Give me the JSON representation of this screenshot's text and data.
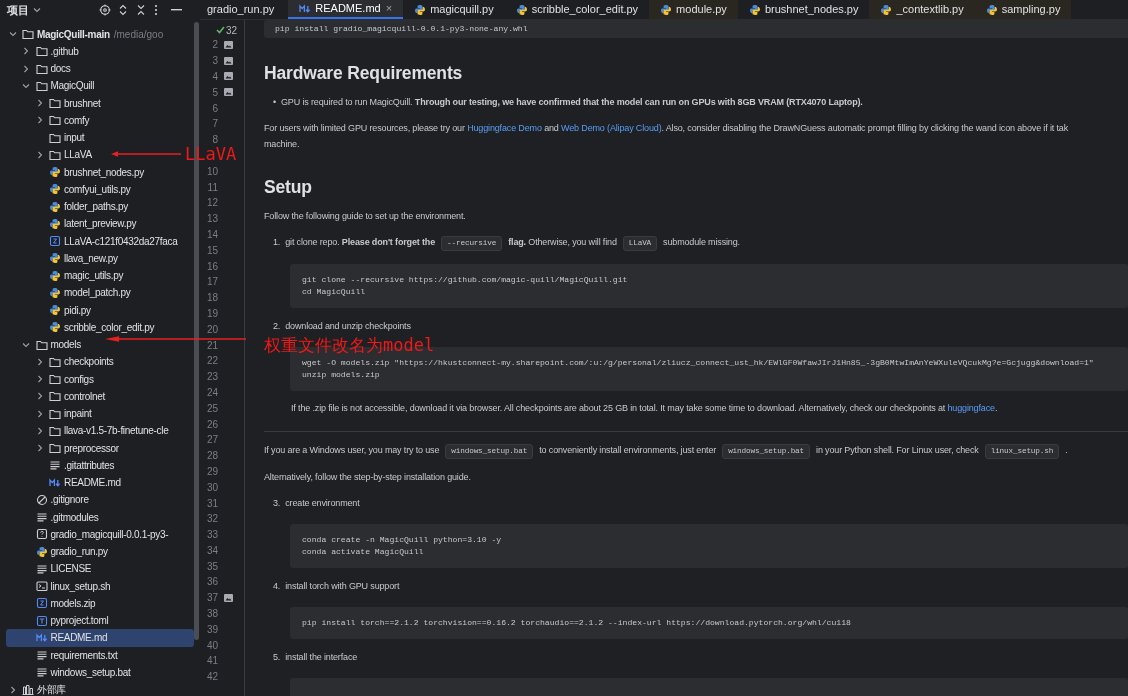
{
  "project_panel": {
    "title": "项目",
    "tree": [
      {
        "name": "MagicQuill-main",
        "kind": "folder",
        "expanded": true,
        "selected": false,
        "hint": "/media/goo",
        "children": [
          {
            "name": ".github",
            "kind": "folder",
            "expanded": false,
            "selected": false
          },
          {
            "name": "docs",
            "kind": "folder",
            "expanded": false,
            "selected": false
          },
          {
            "name": "MagicQuill",
            "kind": "folder",
            "expanded": true,
            "selected": false,
            "children": [
              {
                "name": "brushnet",
                "kind": "folder",
                "expanded": false,
                "selected": false
              },
              {
                "name": "comfy",
                "kind": "folder",
                "expanded": false,
                "selected": false
              },
              {
                "name": "input",
                "kind": "emptyfolder",
                "selected": false
              },
              {
                "name": "LLaVA",
                "kind": "folder",
                "expanded": false,
                "selected": false
              },
              {
                "name": "brushnet_nodes.py",
                "kind": "python",
                "selected": false
              },
              {
                "name": "comfyui_utils.py",
                "kind": "python",
                "selected": false
              },
              {
                "name": "folder_paths.py",
                "kind": "python",
                "selected": false
              },
              {
                "name": "latent_preview.py",
                "kind": "python",
                "selected": false
              },
              {
                "name": "LLaVA-c121f0432da27faca",
                "kind": "archive",
                "selected": false
              },
              {
                "name": "llava_new.py",
                "kind": "python",
                "selected": false
              },
              {
                "name": "magic_utils.py",
                "kind": "python",
                "selected": false
              },
              {
                "name": "model_patch.py",
                "kind": "python",
                "selected": false
              },
              {
                "name": "pidi.py",
                "kind": "python",
                "selected": false
              },
              {
                "name": "scribble_color_edit.py",
                "kind": "python",
                "selected": false
              }
            ]
          },
          {
            "name": "models",
            "kind": "folder",
            "expanded": true,
            "selected": false,
            "children": [
              {
                "name": "checkpoints",
                "kind": "folder",
                "expanded": false,
                "selected": false
              },
              {
                "name": "configs",
                "kind": "folder",
                "expanded": false,
                "selected": false
              },
              {
                "name": "controlnet",
                "kind": "folder",
                "expanded": false,
                "selected": false
              },
              {
                "name": "inpaint",
                "kind": "folder",
                "expanded": false,
                "selected": false
              },
              {
                "name": "llava-v1.5-7b-finetune-cle",
                "kind": "folder",
                "expanded": false,
                "selected": false
              },
              {
                "name": "preprocessor",
                "kind": "folder",
                "expanded": false,
                "selected": false
              },
              {
                "name": ".gitattributes",
                "kind": "lines",
                "selected": false
              },
              {
                "name": "README.md",
                "kind": "markdown",
                "selected": false
              }
            ]
          },
          {
            "name": ".gitignore",
            "kind": "ignore",
            "selected": false
          },
          {
            "name": ".gitmodules",
            "kind": "lines",
            "selected": false
          },
          {
            "name": "gradio_magicquill-0.0.1-py3-",
            "kind": "unknown",
            "selected": false
          },
          {
            "name": "gradio_run.py",
            "kind": "python",
            "selected": false
          },
          {
            "name": "LICENSE",
            "kind": "lines",
            "selected": false
          },
          {
            "name": "linux_setup.sh",
            "kind": "shell",
            "selected": false
          },
          {
            "name": "models.zip",
            "kind": "archive",
            "selected": false
          },
          {
            "name": "pyproject.toml",
            "kind": "toml",
            "selected": false
          },
          {
            "name": "README.md",
            "kind": "markdown",
            "selected": true
          },
          {
            "name": "requirements.txt",
            "kind": "lines",
            "selected": false
          },
          {
            "name": "windows_setup.bat",
            "kind": "lines",
            "selected": false
          }
        ]
      },
      {
        "name": "外部库",
        "kind": "library",
        "expanded": false,
        "selected": false
      }
    ]
  },
  "tabs": [
    {
      "label": "gradio_run.py",
      "kind": "plain",
      "selected": false,
      "external": false
    },
    {
      "label": "README.md",
      "kind": "markdown",
      "selected": true,
      "external": false,
      "close": "×"
    },
    {
      "label": "magicquill.py",
      "kind": "python",
      "selected": false,
      "external": false
    },
    {
      "label": "scribble_color_edit.py",
      "kind": "python",
      "selected": false,
      "external": false
    },
    {
      "label": "module.py",
      "kind": "python",
      "selected": false,
      "external": true
    },
    {
      "label": "brushnet_nodes.py",
      "kind": "python",
      "selected": false,
      "external": false
    },
    {
      "label": "_contextlib.py",
      "kind": "python",
      "selected": false,
      "external": true
    },
    {
      "label": "sampling.py",
      "kind": "python",
      "selected": false,
      "external": true
    }
  ],
  "gutter": {
    "inspection_count": "32",
    "lines": [
      {
        "n": "2",
        "image": true
      },
      {
        "n": "3",
        "image": true
      },
      {
        "n": "4",
        "image": true
      },
      {
        "n": "5",
        "image": true
      },
      {
        "n": "6",
        "image": false
      },
      {
        "n": "7",
        "image": false
      },
      {
        "n": "8",
        "image": false
      },
      {
        "n": "10",
        "image": false
      },
      {
        "n": "11",
        "image": false
      },
      {
        "n": "12",
        "image": false
      },
      {
        "n": "13",
        "image": false
      },
      {
        "n": "14",
        "image": false
      },
      {
        "n": "15",
        "image": false
      },
      {
        "n": "16",
        "image": false
      },
      {
        "n": "17",
        "image": false
      },
      {
        "n": "18",
        "image": false
      },
      {
        "n": "19",
        "image": false
      },
      {
        "n": "20",
        "image": false
      },
      {
        "n": "21",
        "image": false
      },
      {
        "n": "22",
        "image": false
      },
      {
        "n": "23",
        "image": false
      },
      {
        "n": "24",
        "image": false
      },
      {
        "n": "25",
        "image": false
      },
      {
        "n": "26",
        "image": false
      },
      {
        "n": "27",
        "image": false
      },
      {
        "n": "28",
        "image": false
      },
      {
        "n": "29",
        "image": false
      },
      {
        "n": "30",
        "image": false
      },
      {
        "n": "31",
        "image": false
      },
      {
        "n": "32",
        "image": false
      },
      {
        "n": "33",
        "image": false
      },
      {
        "n": "34",
        "image": false
      },
      {
        "n": "35",
        "image": false
      },
      {
        "n": "36",
        "image": false
      },
      {
        "n": "37",
        "image": true
      },
      {
        "n": "38",
        "image": false
      },
      {
        "n": "39",
        "image": false
      },
      {
        "n": "40",
        "image": false
      },
      {
        "n": "41",
        "image": false
      },
      {
        "n": "42",
        "image": false
      }
    ]
  },
  "preview": [
    {
      "kind": "code",
      "lines": [
        "pip install gradio_magicquill-0.0.1-py3-none-any.whl"
      ]
    },
    {
      "kind": "heading",
      "text": "Hardware Requirements"
    },
    {
      "kind": "bullet",
      "marker": "•",
      "parts": [
        {
          "kind": "text",
          "text": "GPU is required to run MagicQuill. **Through our testing, we have confirmed that the model can run on GPUs with 8GB VRAM (RTX4070 Laptop).**"
        }
      ]
    },
    {
      "kind": "para",
      "parts": [
        {
          "kind": "text",
          "text": "For users with limited GPU resources, please try our "
        },
        {
          "kind": "link",
          "text": "Huggingface Demo"
        },
        {
          "kind": "text",
          "text": " and "
        },
        {
          "kind": "link",
          "text": "Web Demo (Alipay Cloud)"
        },
        {
          "kind": "text",
          "text": ". Also, consider disabling the DrawNGuess automatic prompt filling by clicking the wand icon above if it tak"
        },
        {
          "kind": "break"
        },
        {
          "kind": "text",
          "text": "machine."
        }
      ]
    },
    {
      "kind": "heading",
      "text": "Setup"
    },
    {
      "kind": "para",
      "parts": [
        {
          "kind": "text",
          "text": "Follow the following guide to set up the environment."
        }
      ]
    },
    {
      "kind": "ordered",
      "marker": "1.",
      "parts": [
        {
          "kind": "text",
          "text": "git clone repo. **Please don't forget the**"
        },
        {
          "kind": "code",
          "text": "--recursive"
        },
        {
          "kind": "text",
          "text": "**flag.** Otherwise, you will find"
        },
        {
          "kind": "code",
          "text": "LLaVA"
        },
        {
          "kind": "text",
          "text": "submodule missing."
        }
      ],
      "children": [
        {
          "kind": "code",
          "lines": [
            "git clone --recursive https://github.com/magic-quill/MagicQuill.git",
            "cd MagicQuill"
          ]
        }
      ]
    },
    {
      "kind": "ordered",
      "marker": "2.",
      "parts": [
        {
          "kind": "text",
          "text": "download and unzip checkpoints"
        }
      ],
      "children": [
        {
          "kind": "code",
          "lines": [
            "wget -O models.zip \"https://hkustconnect-my.sharepoint.com/:u:/g/personal/zliucz_connect_ust_hk/EWlGF0WfawJIrJ1Hn85_-3gB0MtwImAnYeWXuleVQcukMg?e=Gcjugg&download=1\"",
            "unzip models.zip"
          ]
        },
        {
          "kind": "para",
          "parts": [
            {
              "kind": "text",
              "text": "If the .zip file is not accessible, download it via browser. All checkpoints are about 25 GB in total. It may take some time to download. Alternatively, check our checkpoints at "
            },
            {
              "kind": "link",
              "text": "huggingface"
            },
            {
              "kind": "text",
              "text": "."
            }
          ]
        }
      ]
    },
    {
      "kind": "rule"
    },
    {
      "kind": "para",
      "parts": [
        {
          "kind": "text",
          "text": "If you are a Windows user, you may try to use"
        },
        {
          "kind": "code",
          "text": "windows_setup.bat"
        },
        {
          "kind": "text",
          "text": "to conveniently install environments, just enter"
        },
        {
          "kind": "code",
          "text": "windows_setup.bat"
        },
        {
          "kind": "text",
          "text": "in your Python shell. For Linux user, check"
        },
        {
          "kind": "code",
          "text": "linux_setup.sh"
        },
        {
          "kind": "text",
          "text": "."
        }
      ]
    },
    {
      "kind": "para",
      "parts": [
        {
          "kind": "text",
          "text": "Alternatively, follow the step-by-step installation guide."
        }
      ]
    },
    {
      "kind": "ordered",
      "marker": "3.",
      "parts": [
        {
          "kind": "text",
          "text": "create environment"
        }
      ],
      "children": [
        {
          "kind": "code",
          "lines": [
            "conda create -n MagicQuill python=3.10 -y",
            "conda activate MagicQuill"
          ]
        }
      ]
    },
    {
      "kind": "ordered",
      "marker": "4.",
      "parts": [
        {
          "kind": "text",
          "text": "install torch with GPU support"
        }
      ],
      "children": [
        {
          "kind": "code",
          "lines": [
            "pip install torch==2.1.2 torchvision==0.16.2 torchaudio==2.1.2 --index-url https://download.pytorch.org/whl/cu118"
          ]
        }
      ]
    },
    {
      "kind": "ordered",
      "marker": "5.",
      "parts": [
        {
          "kind": "text",
          "text": "install the interface"
        }
      ],
      "children": [
        {
          "kind": "code"
        }
      ]
    }
  ],
  "annotations": [
    {
      "text": "LLaVA"
    },
    {
      "text": "权重文件改名为model"
    }
  ]
}
